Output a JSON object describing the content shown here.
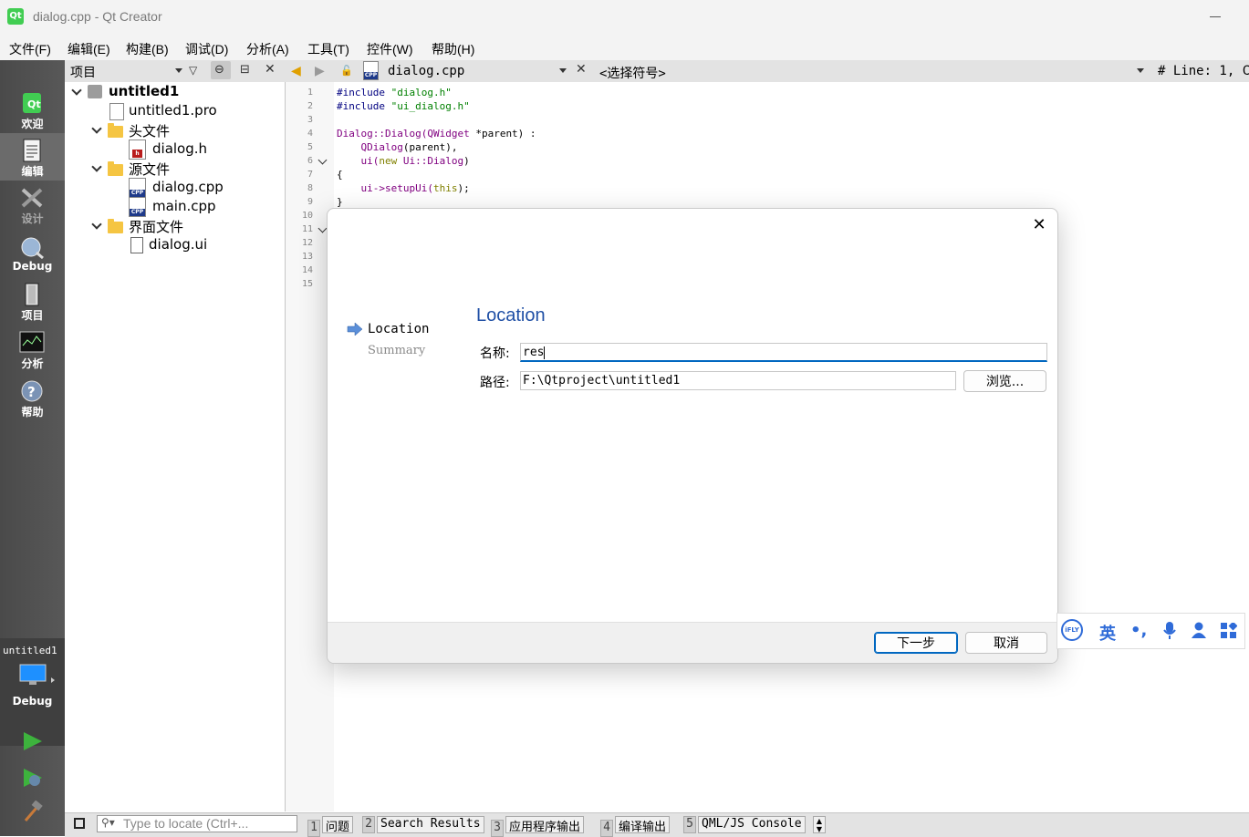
{
  "window": {
    "title": "dialog.cpp - Qt Creator",
    "logo_text": "Qt"
  },
  "menu": [
    "文件(F)",
    "编辑(E)",
    "构建(B)",
    "调试(D)",
    "分析(A)",
    "工具(T)",
    "控件(W)",
    "帮助(H)"
  ],
  "modes": [
    {
      "label": "欢迎"
    },
    {
      "label": "编辑"
    },
    {
      "label": "设计"
    },
    {
      "label": "Debug"
    },
    {
      "label": "项目"
    },
    {
      "label": "分析"
    },
    {
      "label": "帮助"
    }
  ],
  "kit": {
    "project": "untitled1",
    "config": "Debug"
  },
  "project_pane": {
    "title": "项目",
    "tree": {
      "root": "untitled1",
      "pro_file": "untitled1.pro",
      "headers_folder": "头文件",
      "headers": [
        "dialog.h"
      ],
      "sources_folder": "源文件",
      "sources": [
        "dialog.cpp",
        "main.cpp"
      ],
      "forms_folder": "界面文件",
      "forms": [
        "dialog.ui"
      ]
    }
  },
  "editor": {
    "file_name": "dialog.cpp",
    "symbol_selector": "<选择符号>",
    "line_info": "#  Line: 1, C",
    "line_numbers": [
      "1",
      "2",
      "3",
      "4",
      "5",
      "6",
      "7",
      "8",
      "9",
      "10",
      "11",
      "12",
      "13",
      "14",
      "15"
    ],
    "code": {
      "l1a": "#include ",
      "l1b": "\"dialog.h\"",
      "l2a": "#include ",
      "l2b": "\"ui_dialog.h\"",
      "l4a": "Dialog::Dialog(",
      "l4b": "QWidget",
      "l4c": " *parent) :",
      "l5a": "    ",
      "l5b": "QDialog",
      "l5c": "(parent),",
      "l6a": "    ui(",
      "l6b": "new",
      "l6c": " Ui::",
      "l6d": "Dialog",
      "l6e": ")",
      "l7": "{",
      "l8a": "    ui->setupUi(",
      "l8b": "this",
      "l8c": ");",
      "l9": "}"
    }
  },
  "dialog": {
    "steps": [
      "Location",
      "Summary"
    ],
    "heading": "Location",
    "name_label": "名称:",
    "name_value": "res",
    "path_label": "路径:",
    "path_value": "F:\\Qtproject\\untitled1",
    "browse_label": "浏览...",
    "next_label": "下一步",
    "cancel_label": "取消"
  },
  "bottom_bar": {
    "locate_placeholder": "Type to locate (Ctrl+...",
    "tabs": [
      {
        "num": "1",
        "name": "问题"
      },
      {
        "num": "2",
        "name": "Search Results"
      },
      {
        "num": "3",
        "name": "应用程序输出"
      },
      {
        "num": "4",
        "name": "编译输出"
      },
      {
        "num": "5",
        "name": "QML/JS Console"
      }
    ]
  },
  "ime": {
    "logo": "iFLY",
    "lang": "英"
  }
}
